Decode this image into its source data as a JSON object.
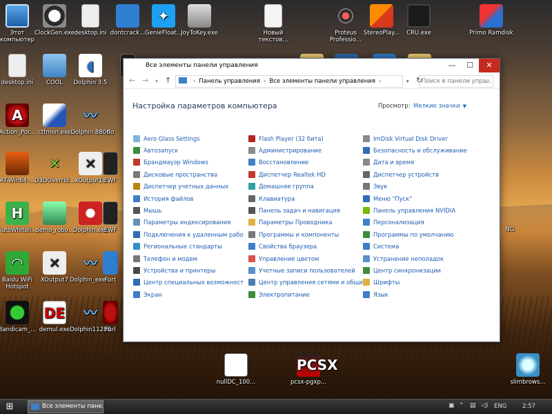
{
  "desktop": {
    "icons": {
      "this_pc": "Этот компьютер",
      "clockgen": "ClockGen.exe",
      "desktop_ini_1": "desktop.ini",
      "dontcrack": "dontcrack...",
      "geniefloat": "GenieFloat...",
      "joytokey": "JoyToKey.exe",
      "new_text": "Новый текстов...",
      "proteus": "Proteus Professio...",
      "stereoplay": "StereoPlay...",
      "cru": "CRU.exe",
      "primo": "Primo Ramdisk",
      "desktop_ini_2": "desktop.ini",
      "cool": "COOL",
      "dolphin35": "Dolphin 3.5",
      "action_por": "Action_Por...",
      "ctfmon": "ctfmon.exe",
      "dolphin8800": "Dolphin 8800",
      "do_partial": "do",
      "at_win64": "AT-Win64-...",
      "d3doverride": "D3DOverrid...",
      "xoutput10": "XOutput10",
      "ewf1": "EWF",
      "autowhitelist": "AutoWhiteli...",
      "demo_robo": "demo_robo...",
      "dolphin_exe": "Dolphin.exe",
      "ewf2": "EWF",
      "baidu": "Baidu WiFi Hotspot",
      "xoutput7": "XOutput7",
      "dolphin_exe2": "Dolphin_exe...",
      "fort": "Fort",
      "bandicam": "Bandicam_...",
      "demul": "demul.exe",
      "dolphin11288": "Dolphin11288",
      "furl": "Furl",
      "nulldc": "nullDC_100...",
      "pcsx": "pcsx-pgxp...",
      "slimbrowser": "slimbrows..."
    },
    "behind_text": "NG"
  },
  "window": {
    "title": "Все элементы панели управления",
    "address": {
      "part1": "Панель управления",
      "part2": "Все элементы панели управления"
    },
    "search_placeholder": "Поиск в панели упра...",
    "heading": "Настройка параметров компьютера",
    "view_label": "Просмотр:",
    "view_value": "Мелкие значки",
    "columns": [
      [
        {
          "label": "Aero Glass Settings",
          "color": "#7fb4e0"
        },
        {
          "label": "Автозапуск",
          "color": "#3c8c3c"
        },
        {
          "label": "Брандмауэр Windows",
          "color": "#c0392b"
        },
        {
          "label": "Дисковые пространства",
          "color": "#7a7a7a"
        },
        {
          "label": "Диспетчер учетных данных",
          "color": "#b8860b"
        },
        {
          "label": "История файлов",
          "color": "#3f7fc8"
        },
        {
          "label": "Мышь",
          "color": "#555555"
        },
        {
          "label": "Параметры индексирования",
          "color": "#6a8fb8"
        },
        {
          "label": "Подключения к удаленным рабоч...",
          "color": "#2f6db5"
        },
        {
          "label": "Региональные стандарты",
          "color": "#2f8fc8"
        },
        {
          "label": "Телефон и модем",
          "color": "#777777"
        },
        {
          "label": "Устройства и принтеры",
          "color": "#4a4a4a"
        },
        {
          "label": "Центр специальных возможностей",
          "color": "#2f6db5"
        },
        {
          "label": "Экран",
          "color": "#3f7fc8"
        }
      ],
      [
        {
          "label": "Flash Player (32 бита)",
          "color": "#b3261e"
        },
        {
          "label": "Администрирование",
          "color": "#8a8a8a"
        },
        {
          "label": "Восстановление",
          "color": "#3f7fc8"
        },
        {
          "label": "Диспетчер Realtek HD",
          "color": "#c0392b"
        },
        {
          "label": "Домашняя группа",
          "color": "#2fa0a0"
        },
        {
          "label": "Клавиатура",
          "color": "#666666"
        },
        {
          "label": "Панель задач и навигация",
          "color": "#555555"
        },
        {
          "label": "Параметры Проводника",
          "color": "#e0b040"
        },
        {
          "label": "Программы и компоненты",
          "color": "#7a7a7a"
        },
        {
          "label": "Свойства браузера",
          "color": "#3f7fc8"
        },
        {
          "label": "Управление цветом",
          "color": "#d9534f"
        },
        {
          "label": "Учетные записи пользователей",
          "color": "#5a8fc8"
        },
        {
          "label": "Центр управления сетями и общи...",
          "color": "#4a7fb0"
        },
        {
          "label": "Электропитание",
          "color": "#3c8c3c"
        }
      ],
      [
        {
          "label": "ImDisk Virtual Disk Driver",
          "color": "#8a8a8a"
        },
        {
          "label": "Безопасность и обслуживание",
          "color": "#2f6db5"
        },
        {
          "label": "Дата и время",
          "color": "#8a8a8a"
        },
        {
          "label": "Диспетчер устройств",
          "color": "#666666"
        },
        {
          "label": "Звук",
          "color": "#777777"
        },
        {
          "label": "Меню \"Пуск\"",
          "color": "#2f6db5"
        },
        {
          "label": "Панель управления NVIDIA",
          "color": "#76b900"
        },
        {
          "label": "Персонализация",
          "color": "#3f7fc8"
        },
        {
          "label": "Программы по умолчанию",
          "color": "#3c8c3c"
        },
        {
          "label": "Система",
          "color": "#3f7fc8"
        },
        {
          "label": "Устранение неполадок",
          "color": "#5a8fc8"
        },
        {
          "label": "Центр синхронизации",
          "color": "#3c8c3c"
        },
        {
          "label": "Шрифты",
          "color": "#e0b040"
        },
        {
          "label": "Язык",
          "color": "#3f7fc8"
        }
      ]
    ]
  },
  "taskbar": {
    "task_label": "Все элементы панеле...",
    "lang": "ENG",
    "time": "2:57"
  }
}
